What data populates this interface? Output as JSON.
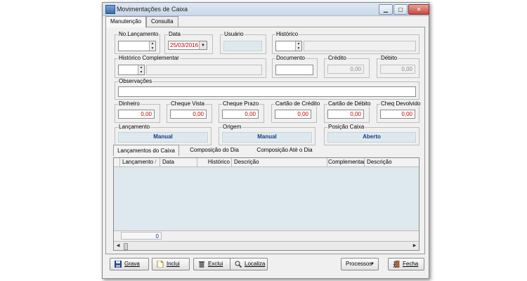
{
  "window": {
    "title": "Movimentações de Caixa"
  },
  "tabs": [
    {
      "label": "Manutenção"
    },
    {
      "label": "Consulta"
    }
  ],
  "form": {
    "no_lancamento": {
      "label": "No.Lançamento",
      "value": ""
    },
    "data": {
      "label": "Data",
      "value": "25/03/2016"
    },
    "usuario": {
      "label": "Usuário",
      "value": ""
    },
    "historico": {
      "label": "Histórico",
      "value": ""
    },
    "historico_complementar": {
      "label": "Histórico Complementar",
      "value": ""
    },
    "documento": {
      "label": "Documento",
      "value": ""
    },
    "credito": {
      "label": "Crédito",
      "value": "0,00"
    },
    "debito": {
      "label": "Débito",
      "value": "0,00"
    },
    "observacoes": {
      "label": "Observações",
      "value": ""
    },
    "dinheiro": {
      "label": "Dinheiro",
      "value": "0,00"
    },
    "cheque_vista": {
      "label": "Cheque Vista",
      "value": "0,00"
    },
    "cheque_prazo": {
      "label": "Cheque Prazo",
      "value": "0,00"
    },
    "cartao_credito": {
      "label": "Cartão de Crédito",
      "value": "0,00"
    },
    "cartao_debito": {
      "label": "Cartão de Débito",
      "value": "0,00"
    },
    "cheq_devolvido": {
      "label": "Cheq Devolvido",
      "value": "0,00"
    },
    "lancamento": {
      "label": "Lançamento",
      "value": "Manual"
    },
    "origem": {
      "label": "Origem",
      "value": "Manual"
    },
    "posicao_caixa": {
      "label": "Posição Caixa",
      "value": "Aberto"
    }
  },
  "subtabs": [
    {
      "label": "Lançamentos do Caixa"
    },
    {
      "label": "Composição do Dia"
    },
    {
      "label": "Composição Até o Dia"
    }
  ],
  "grid": {
    "columns": [
      "Lançamento",
      "Data",
      "Histórico",
      "Descrição",
      "Complementar",
      "Descrição"
    ],
    "sort_indicator": "/",
    "count": "0"
  },
  "buttons": {
    "grava": "Grava",
    "inclui": "Inclui",
    "exclui": "Exclui",
    "localiza": "Localiza",
    "processos": "Processos",
    "fecha": "Fecha"
  },
  "colors": {
    "accent_blue": "#1d3a8a",
    "value_red": "#c00000",
    "readonly_fill": "#dde9ee"
  }
}
